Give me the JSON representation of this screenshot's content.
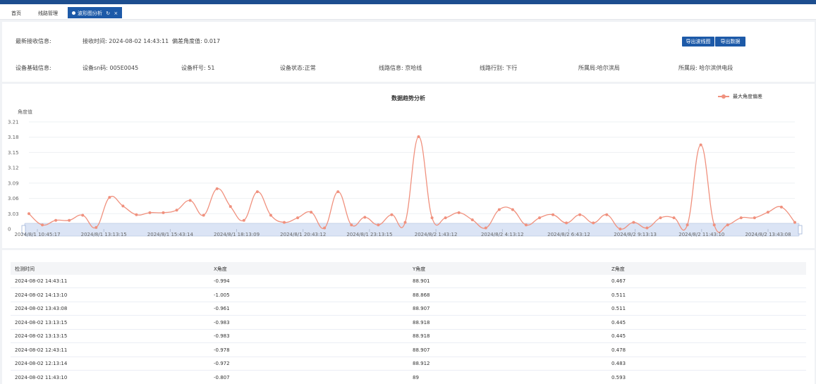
{
  "tabs": [
    {
      "label": "首页"
    },
    {
      "label": "线路管理"
    },
    {
      "label": "波形图分析",
      "active": true
    }
  ],
  "info": {
    "latest_label": "最新接收信息:",
    "receive_time": "接收时间: 2024-08-02 14:43:11",
    "deviation": "偏差角度值: 0.017",
    "device_label": "设备基础信息:",
    "device_sn": "设备sn码: 005E0045",
    "pole_no": "设备杆号: 51",
    "device_status": "设备状态:正常",
    "line_info": "线路信息: 京哈线",
    "line_direction": "线路行别: 下行",
    "bureau": "所属局:哈尔滨局",
    "section": "所属段: 哈尔滨供电段",
    "export_chart": "导出波线图",
    "export_data": "导出数据"
  },
  "chart_data": {
    "type": "line",
    "title": "数据趋势分析",
    "ylabel": "角度值",
    "ylim": [
      0,
      3.21
    ],
    "yticks": [
      "3.21",
      "3.18",
      "3.15",
      "3.12",
      "3.09",
      "3.06",
      "3.03",
      "0"
    ],
    "x_labels": [
      "2024/8/1 10:45:17",
      "2024/8/1 13:13:15",
      "2024/8/1 15:43:14",
      "2024/8/1 18:13:09",
      "2024/8/1 20:43:12",
      "2024/8/1 23:13:15",
      "2024/8/2 1:43:12",
      "2024/8/2 4:13:12",
      "2024/8/2 6:43:12",
      "2024/8/2 9:13:13",
      "2024/8/2 11:43:10",
      "2024/8/2 13:43:08"
    ],
    "series": [
      {
        "name": "最大角度偏差",
        "color": "#f0917e",
        "values": [
          3.03,
          3.008,
          3.017,
          3.017,
          3.027,
          3.003,
          3.062,
          3.045,
          3.028,
          3.032,
          3.032,
          3.037,
          3.056,
          3.027,
          3.079,
          3.044,
          3.017,
          3.073,
          3.027,
          3.013,
          3.022,
          3.033,
          3.002,
          3.073,
          3.008,
          3.023,
          3.008,
          3.028,
          3.013,
          3.181,
          3.022,
          3.022,
          3.032,
          3.018,
          3.002,
          3.038,
          3.038,
          3.008,
          3.022,
          3.028,
          3.012,
          3.028,
          3.012,
          3.028,
          2.998,
          3.013,
          3.002,
          3.022,
          3.022,
          3.008,
          3.165,
          3.008,
          3.008,
          3.022,
          3.022,
          3.033,
          3.043,
          3.013
        ]
      }
    ]
  },
  "table": {
    "headers": [
      "检测时间",
      "X角度",
      "Y角度",
      "Z角度"
    ],
    "rows": [
      [
        "2024-08-02 14:43:11",
        "-0.994",
        "88.901",
        "0.467"
      ],
      [
        "2024-08-02 14:13:10",
        "-1.005",
        "88.868",
        "0.511"
      ],
      [
        "2024-08-02 13:43:08",
        "-0.961",
        "88.907",
        "0.511"
      ],
      [
        "2024-08-02 13:13:15",
        "-0.983",
        "88.918",
        "0.445"
      ],
      [
        "2024-08-02 13:13:15",
        "-0.983",
        "88.918",
        "0.445"
      ],
      [
        "2024-08-02 12:43:11",
        "-0.978",
        "88.907",
        "0.478"
      ],
      [
        "2024-08-02 12:13:14",
        "-0.972",
        "88.912",
        "0.483"
      ],
      [
        "2024-08-02 11:43:10",
        "-0.807",
        "89",
        "0.593"
      ]
    ]
  }
}
